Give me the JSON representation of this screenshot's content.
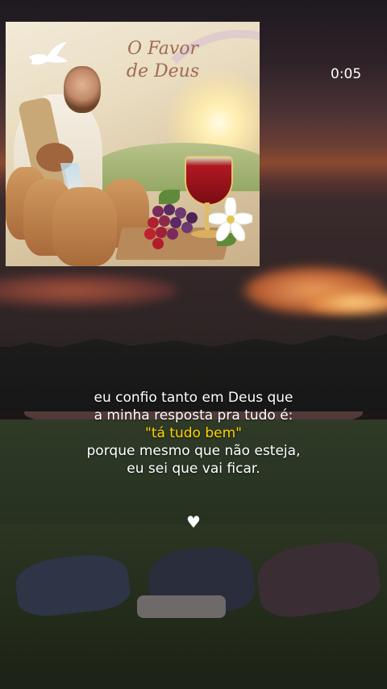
{
  "video": {
    "timestamp": "0:05"
  },
  "cover_art": {
    "title_line1": "O Favor",
    "title_line2": "de Deus"
  },
  "caption": {
    "line1": "eu confio tanto em Deus que",
    "line2": "a minha resposta pra tudo é:",
    "line3": "\"tá  tudo bem\"",
    "line4": "porque mesmo que não esteja,",
    "line5": "eu sei que vai ficar.",
    "highlight_color": "#ffd200"
  },
  "reaction": {
    "icon": "heart-icon",
    "glyph": "♥"
  }
}
